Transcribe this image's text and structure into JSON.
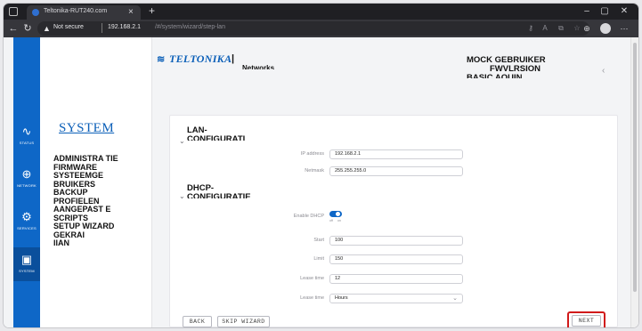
{
  "browser": {
    "tab_title": "Teltonika-RUT240.com",
    "tab_close": "×",
    "new_tab": "+",
    "not_secure": "Not secure",
    "url_host": "192.168.2.1",
    "url_path": "/#/system/wizard/step-lan",
    "win_minimize": "–",
    "win_maximize": "▢",
    "win_close": "✕"
  },
  "rail": {
    "items": [
      {
        "label": "STATUS",
        "icon": "pulse-icon",
        "glyph": "∿"
      },
      {
        "label": "NETWORK",
        "icon": "globe-icon",
        "glyph": "⊕"
      },
      {
        "label": "SERVICES",
        "icon": "gear-icon",
        "glyph": "⚙"
      },
      {
        "label": "SYSTEM",
        "icon": "system-icon",
        "glyph": "▣"
      }
    ]
  },
  "system_menu": {
    "title": "SYSTEM",
    "items": [
      "ADMINISTRA TIE",
      "FIRMWARE",
      "SYSTEEMGE BRUIKERS",
      "BACKUP",
      "PROFIELEN",
      "AANGEPAST E SCRIPTS",
      "SETUP WIZARD",
      "GEKRAI",
      "IIAN"
    ]
  },
  "header": {
    "logo_text": "TELTONIKA",
    "logo_bar": "|",
    "logo_sub": "Networks",
    "line1": "MOCK      GEBRUIKER",
    "line2": "FWVLRSION",
    "line3": "BASIC AQUIN",
    "chevron": "‹"
  },
  "lan": {
    "title_line1": "LAN-",
    "title_line2": "CONFIGURATI",
    "chevron": "⌄",
    "ip_label": "IP address",
    "ip_value": "192.168.2.1",
    "netmask_label": "Netmask",
    "netmask_value": "255.255.255.0"
  },
  "dhcp": {
    "title_line1": "DHCP-",
    "title_line2": "CONFIGURATIE",
    "chevron": "⌄",
    "enable_label": "Enable DHCP",
    "toggle_off": "off",
    "toggle_on": "on",
    "start_label": "Start",
    "start_value": "100",
    "limit_label": "Limit",
    "limit_value": "150",
    "lease_time_label": "Lease time",
    "lease_time_value": "12",
    "lease_unit_label": "Lease time",
    "lease_unit_value": "Hours",
    "lease_unit_arrow": "⌄"
  },
  "actions": {
    "back": "BACK",
    "skip": "SKIP WIZARD",
    "next": "NEXT"
  }
}
